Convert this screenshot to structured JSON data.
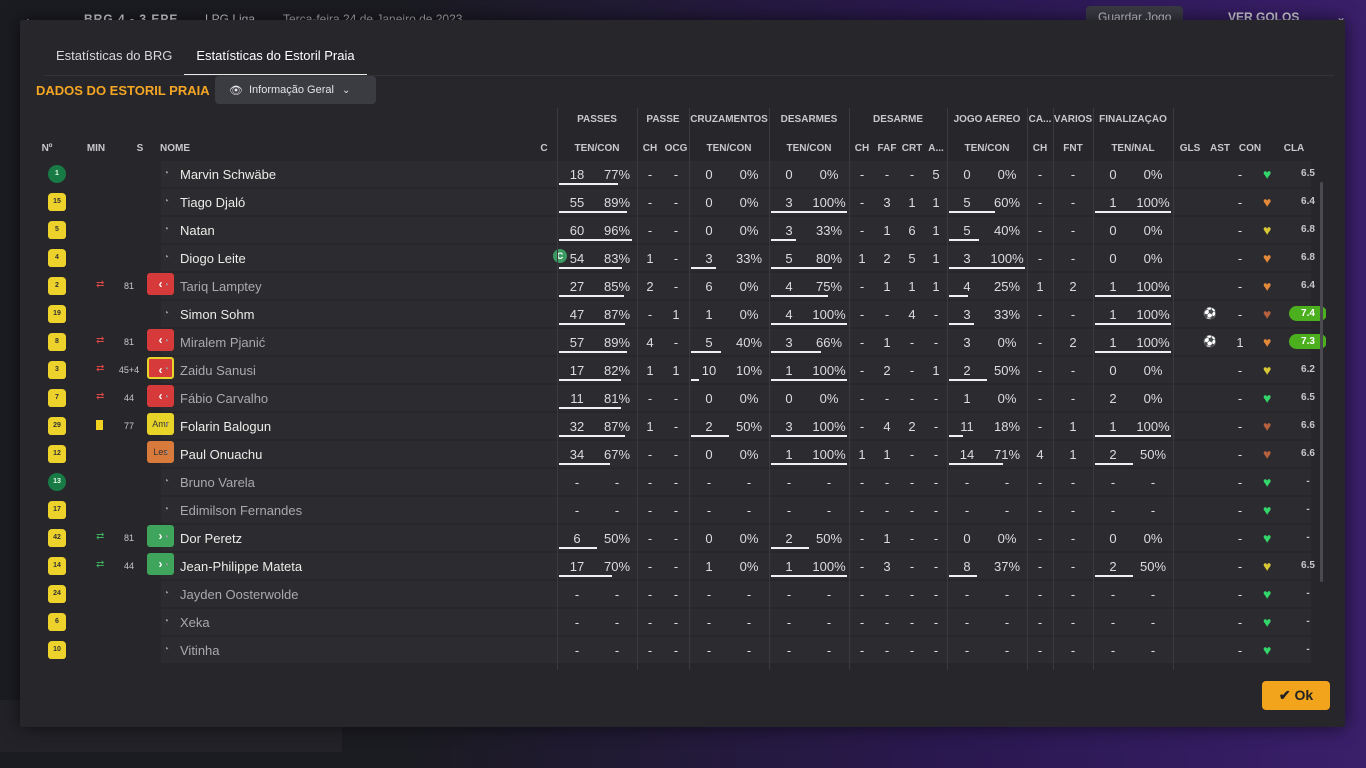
{
  "topbar": {
    "back": "←",
    "score": "BRG 4 - 3 EPE",
    "league": "LPG Liga",
    "date": "Terça-feira 24 de Janeiro de 2023",
    "save": "Guardar Jogo",
    "golos": "VER GOLOS"
  },
  "tabs": [
    "Estatísticas do BRG",
    "Estatísticas do Estoril Praia"
  ],
  "section_title": "DADOS DO ESTORIL PRAIA",
  "dropdown": {
    "label": "Informação Geral"
  },
  "groups": [
    "PASSES",
    "PASSE",
    "CRUZAMENTOS",
    "DESARMES",
    "DESARME",
    "JOGO AÉREO",
    "CA...",
    "VÁRIOS",
    "FINALIZAÇÃO"
  ],
  "headers": {
    "num": "Nº",
    "min": "MIN",
    "s": "S",
    "nome": "NOME",
    "c": "C",
    "passes": "TEN/CON",
    "ch": "CH",
    "ocg": "OCG",
    "cruz": "TEN/CON",
    "desarmes": "TEN/CON",
    "dch": "CH",
    "faf": "FAF",
    "crt": "CRT",
    "a": "A...",
    "aereo": "TEN/CON",
    "cch": "CH",
    "fnt": "FNT",
    "fin": "TEN/NAL",
    "gls": "GLS",
    "ast": "AST",
    "con": "CON",
    "cla": "CLA"
  },
  "players": [
    {
      "n": "1",
      "kit": "g",
      "name": "Marvin Schwäbe",
      "p": [
        "18",
        "77%"
      ],
      "pch": "-",
      "ocg": "-",
      "cr": [
        "0",
        "0%"
      ],
      "de": [
        "0",
        "0%"
      ],
      "dch": "-",
      "faf": "-",
      "crt": "-",
      "a": "5",
      "ae": [
        "0",
        "0%"
      ],
      "cch": "-",
      "fnt": "-",
      "fi": [
        "0",
        "0%"
      ],
      "gls": "",
      "ast": "-",
      "con": "green",
      "cla": "6.5"
    },
    {
      "n": "15",
      "kit": "y",
      "name": "Tiago Djaló",
      "p": [
        "55",
        "89%"
      ],
      "pch": "-",
      "ocg": "-",
      "cr": [
        "0",
        "0%"
      ],
      "de": [
        "3",
        "100%"
      ],
      "dch": "-",
      "faf": "3",
      "crt": "1",
      "a": "1",
      "ae": [
        "5",
        "60%"
      ],
      "cch": "-",
      "fnt": "-",
      "fi": [
        "1",
        "100%"
      ],
      "gls": "",
      "ast": "-",
      "con": "orange",
      "cla": "6.4"
    },
    {
      "n": "5",
      "kit": "y",
      "name": "Natan",
      "p": [
        "60",
        "96%"
      ],
      "pch": "-",
      "ocg": "-",
      "cr": [
        "0",
        "0%"
      ],
      "de": [
        "3",
        "33%"
      ],
      "dch": "-",
      "faf": "1",
      "crt": "6",
      "a": "1",
      "ae": [
        "5",
        "40%"
      ],
      "cch": "-",
      "fnt": "-",
      "fi": [
        "0",
        "0%"
      ],
      "gls": "",
      "ast": "-",
      "con": "yellow",
      "cla": "6.8"
    },
    {
      "n": "4",
      "kit": "y",
      "name": "Diogo Leite",
      "cap": "C",
      "p": [
        "54",
        "83%"
      ],
      "pch": "1",
      "ocg": "-",
      "cr": [
        "3",
        "33%"
      ],
      "de": [
        "5",
        "80%"
      ],
      "dch": "1",
      "faf": "2",
      "crt": "5",
      "a": "1",
      "ae": [
        "3",
        "100%"
      ],
      "cch": "-",
      "fnt": "-",
      "fi": [
        "0",
        "0%"
      ],
      "gls": "",
      "ast": "-",
      "con": "orange",
      "cla": "6.8"
    },
    {
      "n": "2",
      "kit": "y",
      "dim": true,
      "sub": "out",
      "min": "81",
      "name": "Tariq Lamptey",
      "p": [
        "27",
        "85%"
      ],
      "pch": "2",
      "ocg": "-",
      "cr": [
        "6",
        "0%"
      ],
      "de": [
        "4",
        "75%"
      ],
      "dch": "-",
      "faf": "1",
      "crt": "1",
      "a": "1",
      "ae": [
        "4",
        "25%"
      ],
      "cch": "1",
      "fnt": "2",
      "fi": [
        "1",
        "100%"
      ],
      "gls": "",
      "ast": "-",
      "con": "orange",
      "cla": "6.4"
    },
    {
      "n": "19",
      "kit": "y",
      "name": "Simon Sohm",
      "p": [
        "47",
        "87%"
      ],
      "pch": "-",
      "ocg": "1",
      "cr": [
        "1",
        "0%"
      ],
      "de": [
        "4",
        "100%"
      ],
      "dch": "-",
      "faf": "-",
      "crt": "4",
      "a": "-",
      "ae": [
        "3",
        "33%"
      ],
      "cch": "-",
      "fnt": "-",
      "fi": [
        "1",
        "100%"
      ],
      "gls": "⚽",
      "ast": "-",
      "con": "brown",
      "cla": "7.4"
    },
    {
      "n": "8",
      "kit": "y",
      "dim": true,
      "sub": "out",
      "min": "81",
      "name": "Miralem Pjanić",
      "p": [
        "57",
        "89%"
      ],
      "pch": "4",
      "ocg": "-",
      "cr": [
        "5",
        "40%"
      ],
      "de": [
        "3",
        "66%"
      ],
      "dch": "-",
      "faf": "1",
      "crt": "-",
      "a": "-",
      "ae": [
        "3",
        "0%"
      ],
      "cch": "-",
      "fnt": "2",
      "fi": [
        "1",
        "100%"
      ],
      "gls": "⚽",
      "ast": "1",
      "con": "orange",
      "cla": "7.3"
    },
    {
      "n": "3",
      "kit": "y",
      "dim": true,
      "sub": "outb",
      "min": "45+4",
      "name": "Zaidu Sanusi",
      "p": [
        "17",
        "82%"
      ],
      "pch": "1",
      "ocg": "1",
      "cr": [
        "10",
        "10%"
      ],
      "de": [
        "1",
        "100%"
      ],
      "dch": "-",
      "faf": "2",
      "crt": "-",
      "a": "1",
      "ae": [
        "2",
        "50%"
      ],
      "cch": "-",
      "fnt": "-",
      "fi": [
        "0",
        "0%"
      ],
      "gls": "",
      "ast": "-",
      "con": "yellow",
      "cla": "6.2"
    },
    {
      "n": "7",
      "kit": "y",
      "dim": true,
      "sub": "out",
      "min": "44",
      "name": "Fábio Carvalho",
      "p": [
        "11",
        "81%"
      ],
      "pch": "-",
      "ocg": "-",
      "cr": [
        "0",
        "0%"
      ],
      "de": [
        "0",
        "0%"
      ],
      "dch": "-",
      "faf": "-",
      "crt": "-",
      "a": "-",
      "ae": [
        "1",
        "0%"
      ],
      "cch": "-",
      "fnt": "-",
      "fi": [
        "2",
        "0%"
      ],
      "gls": "",
      "ast": "-",
      "con": "green",
      "cla": "6.5"
    },
    {
      "n": "29",
      "kit": "y",
      "ycard": true,
      "card": "amr",
      "min": "77",
      "name": "Folarin Balogun",
      "p": [
        "32",
        "87%"
      ],
      "pch": "1",
      "ocg": "-",
      "cr": [
        "2",
        "50%"
      ],
      "de": [
        "3",
        "100%"
      ],
      "dch": "-",
      "faf": "4",
      "crt": "2",
      "a": "-",
      "ae": [
        "11",
        "18%"
      ],
      "cch": "-",
      "fnt": "1",
      "fi": [
        "1",
        "100%"
      ],
      "gls": "",
      "ast": "-",
      "con": "brown",
      "cla": "6.6"
    },
    {
      "n": "12",
      "kit": "y",
      "card": "les",
      "name": "Paul Onuachu",
      "p": [
        "34",
        "67%"
      ],
      "pch": "-",
      "ocg": "-",
      "cr": [
        "0",
        "0%"
      ],
      "de": [
        "1",
        "100%"
      ],
      "dch": "1",
      "faf": "1",
      "crt": "-",
      "a": "-",
      "ae": [
        "14",
        "71%"
      ],
      "cch": "4",
      "fnt": "1",
      "fi": [
        "2",
        "50%"
      ],
      "gls": "",
      "ast": "-",
      "con": "brown",
      "cla": "6.6"
    },
    {
      "n": "13",
      "kit": "g",
      "dim": true,
      "name": "Bruno Varela",
      "p": [
        "-",
        "-"
      ],
      "pch": "-",
      "ocg": "-",
      "cr": [
        "-",
        "-"
      ],
      "de": [
        "-",
        "-"
      ],
      "dch": "-",
      "faf": "-",
      "crt": "-",
      "a": "-",
      "ae": [
        "-",
        "-"
      ],
      "cch": "-",
      "fnt": "-",
      "fi": [
        "-",
        "-"
      ],
      "gls": "",
      "ast": "-",
      "con": "green",
      "cla": "-"
    },
    {
      "n": "17",
      "kit": "y",
      "dim": true,
      "name": "Edimilson Fernandes",
      "p": [
        "-",
        "-"
      ],
      "pch": "-",
      "ocg": "-",
      "cr": [
        "-",
        "-"
      ],
      "de": [
        "-",
        "-"
      ],
      "dch": "-",
      "faf": "-",
      "crt": "-",
      "a": "-",
      "ae": [
        "-",
        "-"
      ],
      "cch": "-",
      "fnt": "-",
      "fi": [
        "-",
        "-"
      ],
      "gls": "",
      "ast": "-",
      "con": "green",
      "cla": "-"
    },
    {
      "n": "42",
      "kit": "y",
      "sub": "in",
      "min": "81",
      "name": "Dor Peretz",
      "p": [
        "6",
        "50%"
      ],
      "pch": "-",
      "ocg": "-",
      "cr": [
        "0",
        "0%"
      ],
      "de": [
        "2",
        "50%"
      ],
      "dch": "-",
      "faf": "1",
      "crt": "-",
      "a": "-",
      "ae": [
        "0",
        "0%"
      ],
      "cch": "-",
      "fnt": "-",
      "fi": [
        "0",
        "0%"
      ],
      "gls": "",
      "ast": "-",
      "con": "green",
      "cla": "-"
    },
    {
      "n": "14",
      "kit": "y",
      "sub": "in",
      "min": "44",
      "name": "Jean-Philippe Mateta",
      "p": [
        "17",
        "70%"
      ],
      "pch": "-",
      "ocg": "-",
      "cr": [
        "1",
        "0%"
      ],
      "de": [
        "1",
        "100%"
      ],
      "dch": "-",
      "faf": "3",
      "crt": "-",
      "a": "-",
      "ae": [
        "8",
        "37%"
      ],
      "cch": "-",
      "fnt": "-",
      "fi": [
        "2",
        "50%"
      ],
      "gls": "",
      "ast": "-",
      "con": "yellow",
      "cla": "6.5"
    },
    {
      "n": "24",
      "kit": "y",
      "dim": true,
      "name": "Jayden Oosterwolde",
      "p": [
        "-",
        "-"
      ],
      "pch": "-",
      "ocg": "-",
      "cr": [
        "-",
        "-"
      ],
      "de": [
        "-",
        "-"
      ],
      "dch": "-",
      "faf": "-",
      "crt": "-",
      "a": "-",
      "ae": [
        "-",
        "-"
      ],
      "cch": "-",
      "fnt": "-",
      "fi": [
        "-",
        "-"
      ],
      "gls": "",
      "ast": "-",
      "con": "green",
      "cla": "-"
    },
    {
      "n": "6",
      "kit": "y",
      "dim": true,
      "name": "Xeka",
      "p": [
        "-",
        "-"
      ],
      "pch": "-",
      "ocg": "-",
      "cr": [
        "-",
        "-"
      ],
      "de": [
        "-",
        "-"
      ],
      "dch": "-",
      "faf": "-",
      "crt": "-",
      "a": "-",
      "ae": [
        "-",
        "-"
      ],
      "cch": "-",
      "fnt": "-",
      "fi": [
        "-",
        "-"
      ],
      "gls": "",
      "ast": "-",
      "con": "green",
      "cla": "-"
    },
    {
      "n": "10",
      "kit": "y",
      "dim": true,
      "name": "Vitinha",
      "p": [
        "-",
        "-"
      ],
      "pch": "-",
      "ocg": "-",
      "cr": [
        "-",
        "-"
      ],
      "de": [
        "-",
        "-"
      ],
      "dch": "-",
      "faf": "-",
      "crt": "-",
      "a": "-",
      "ae": [
        "-",
        "-"
      ],
      "cch": "-",
      "fnt": "-",
      "fi": [
        "-",
        "-"
      ],
      "gls": "",
      "ast": "-",
      "con": "green",
      "cla": "-"
    }
  ],
  "ok_label": "✔ Ok",
  "colors": {
    "accent": "#f5a623",
    "green": "#33d66a",
    "orange": "#e58a3a",
    "yellow": "#d9c836",
    "brown": "#b5603e"
  }
}
